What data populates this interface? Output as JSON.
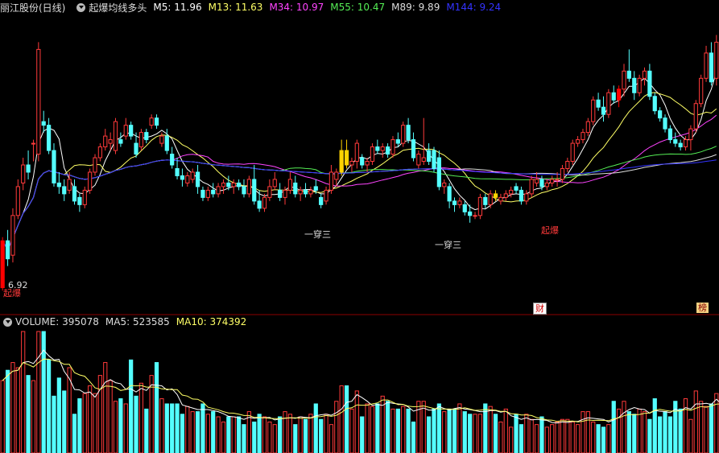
{
  "header": {
    "stock": "丽江股份(日线)",
    "indicator": "起爆均线多头",
    "ma": [
      {
        "label": "M5: 11.96",
        "color": "#ffffff"
      },
      {
        "label": "M13: 11.63",
        "color": "#ffff66"
      },
      {
        "label": "M34: 10.97",
        "color": "#ff44ff"
      },
      {
        "label": "M55: 10.47",
        "color": "#55ee55"
      },
      {
        "label": "M89: 9.89",
        "color": "#dddddd"
      },
      {
        "label": "M144: 9.24",
        "color": "#3333ff"
      }
    ]
  },
  "volume_header": {
    "volume": "VOLUME: 395078",
    "ma5": "MA5: 523585",
    "ma10": "MA10: 374392"
  },
  "annotations": {
    "low_price": "6.92",
    "qibao": "起爆",
    "yichuan_san": "一穿三",
    "cai": "财",
    "bang": "榜"
  },
  "colors": {
    "up": "#ff3a3a",
    "down": "#54ffff",
    "signal_yellow": "#ffd200",
    "signal_red": "#ff0000",
    "divider": "#8b0000",
    "vol_ma5": "#ffffff",
    "vol_ma10": "#ffff66"
  },
  "chart_data": {
    "type": "candlestick",
    "ylim_price": [
      6.5,
      14.3
    ],
    "candles": [
      [
        7.0,
        8.4,
        6.92,
        8.3
      ],
      [
        8.3,
        8.6,
        7.6,
        7.8
      ],
      [
        7.9,
        9.2,
        7.7,
        9.0
      ],
      [
        9.0,
        10.0,
        8.9,
        9.8
      ],
      [
        9.9,
        10.6,
        9.7,
        10.4
      ],
      [
        10.4,
        10.8,
        10.0,
        10.2
      ],
      [
        11.0,
        11.1,
        10.5,
        11.0
      ],
      [
        10.7,
        13.8,
        10.5,
        13.6
      ],
      [
        11.6,
        11.9,
        11.3,
        11.5
      ],
      [
        11.5,
        11.7,
        10.7,
        10.8
      ],
      [
        10.8,
        11.0,
        9.8,
        9.9
      ],
      [
        9.9,
        10.2,
        9.6,
        9.8
      ],
      [
        9.8,
        10.0,
        9.4,
        9.6
      ],
      [
        9.7,
        10.2,
        9.6,
        10.0
      ],
      [
        9.8,
        10.0,
        9.3,
        9.4
      ],
      [
        9.5,
        9.6,
        9.1,
        9.3
      ],
      [
        9.3,
        9.8,
        9.2,
        9.7
      ],
      [
        9.7,
        10.3,
        9.6,
        10.2
      ],
      [
        10.2,
        10.7,
        10.1,
        10.6
      ],
      [
        10.6,
        11.0,
        10.5,
        10.9
      ],
      [
        10.9,
        11.4,
        10.8,
        11.2
      ],
      [
        11.0,
        11.3,
        10.8,
        11.1
      ],
      [
        10.8,
        11.7,
        10.7,
        11.6
      ],
      [
        11.1,
        11.3,
        10.9,
        11.0
      ],
      [
        11.2,
        11.7,
        11.1,
        11.5
      ],
      [
        11.5,
        11.6,
        11.1,
        11.2
      ],
      [
        11.0,
        11.3,
        10.6,
        10.7
      ],
      [
        10.9,
        11.4,
        10.8,
        11.3
      ],
      [
        11.3,
        11.4,
        11.0,
        11.1
      ],
      [
        11.5,
        11.8,
        11.4,
        11.7
      ],
      [
        11.7,
        11.8,
        11.4,
        11.5
      ],
      [
        11.0,
        11.3,
        10.9,
        11.2
      ],
      [
        11.2,
        11.4,
        10.7,
        10.8
      ],
      [
        10.7,
        10.9,
        10.3,
        10.4
      ],
      [
        10.3,
        10.6,
        10.0,
        10.1
      ],
      [
        10.1,
        10.3,
        9.8,
        10.0
      ],
      [
        9.9,
        10.2,
        9.8,
        10.1
      ],
      [
        10.0,
        10.3,
        9.9,
        10.2
      ],
      [
        10.2,
        10.4,
        9.6,
        9.8
      ],
      [
        9.7,
        9.8,
        9.4,
        9.5
      ],
      [
        9.5,
        9.8,
        9.4,
        9.7
      ],
      [
        9.7,
        9.9,
        9.5,
        9.6
      ],
      [
        9.6,
        9.9,
        9.5,
        9.8
      ],
      [
        9.8,
        10.0,
        9.6,
        9.9
      ],
      [
        9.9,
        10.1,
        9.7,
        9.8
      ],
      [
        9.8,
        10.0,
        9.6,
        9.9
      ],
      [
        9.9,
        10.0,
        9.7,
        9.8
      ],
      [
        9.8,
        10.0,
        9.5,
        9.6
      ],
      [
        9.6,
        10.1,
        9.5,
        10.0
      ],
      [
        10.0,
        10.4,
        9.3,
        9.4
      ],
      [
        9.4,
        9.7,
        9.1,
        9.2
      ],
      [
        9.2,
        9.6,
        9.1,
        9.5
      ],
      [
        9.5,
        10.0,
        9.4,
        9.8
      ],
      [
        9.8,
        10.2,
        9.7,
        10.0
      ],
      [
        9.7,
        9.9,
        9.4,
        9.5
      ],
      [
        9.5,
        9.8,
        9.3,
        9.7
      ],
      [
        9.7,
        10.2,
        9.6,
        10.0
      ],
      [
        9.9,
        10.1,
        9.5,
        9.6
      ],
      [
        9.6,
        9.8,
        9.4,
        9.7
      ],
      [
        9.7,
        9.9,
        9.5,
        9.6
      ],
      [
        9.6,
        9.8,
        9.5,
        9.7
      ],
      [
        9.8,
        10.0,
        9.6,
        9.7
      ],
      [
        9.5,
        9.6,
        9.2,
        9.3
      ],
      [
        9.4,
        9.8,
        9.3,
        9.7
      ],
      [
        9.7,
        10.4,
        9.6,
        10.2
      ],
      [
        10.0,
        10.3,
        9.8,
        10.2
      ],
      [
        10.2,
        11.1,
        10.1,
        10.8
      ],
      [
        10.8,
        11.1,
        10.3,
        10.4
      ],
      [
        10.4,
        10.6,
        10.2,
        10.5
      ],
      [
        10.5,
        11.1,
        10.3,
        11.0
      ],
      [
        10.6,
        10.7,
        10.3,
        10.4
      ],
      [
        10.4,
        10.6,
        10.2,
        10.5
      ],
      [
        10.5,
        11.0,
        10.4,
        10.9
      ],
      [
        10.9,
        11.1,
        10.7,
        10.8
      ],
      [
        10.8,
        11.0,
        10.6,
        10.9
      ],
      [
        10.9,
        11.0,
        10.6,
        10.7
      ],
      [
        10.7,
        11.2,
        10.6,
        11.1
      ],
      [
        11.1,
        11.3,
        10.9,
        11.0
      ],
      [
        11.0,
        11.6,
        10.9,
        11.5
      ],
      [
        11.5,
        11.7,
        11.0,
        11.1
      ],
      [
        11.1,
        11.3,
        10.5,
        10.6
      ],
      [
        10.4,
        10.8,
        10.3,
        10.7
      ],
      [
        10.5,
        11.7,
        10.4,
        10.6
      ],
      [
        10.8,
        11.0,
        10.4,
        10.5
      ],
      [
        10.8,
        10.9,
        10.2,
        10.3
      ],
      [
        10.6,
        10.8,
        9.7,
        9.8
      ],
      [
        9.8,
        10.0,
        9.6,
        9.9
      ],
      [
        9.8,
        9.9,
        9.2,
        9.4
      ],
      [
        9.4,
        9.5,
        9.1,
        9.3
      ],
      [
        9.3,
        9.5,
        9.2,
        9.4
      ],
      [
        9.3,
        9.4,
        9.0,
        9.1
      ],
      [
        9.1,
        9.3,
        8.8,
        9.0
      ],
      [
        9.0,
        9.1,
        8.9,
        9.0
      ],
      [
        9.0,
        9.6,
        8.9,
        9.5
      ],
      [
        9.5,
        9.6,
        9.2,
        9.3
      ],
      [
        9.3,
        9.7,
        9.2,
        9.6
      ],
      [
        9.6,
        9.7,
        9.4,
        9.5
      ],
      [
        9.4,
        9.6,
        9.3,
        9.5
      ],
      [
        9.5,
        9.7,
        9.4,
        9.6
      ],
      [
        9.6,
        9.8,
        9.5,
        9.7
      ],
      [
        9.8,
        9.9,
        9.6,
        9.7
      ],
      [
        9.7,
        9.8,
        9.3,
        9.4
      ],
      [
        9.4,
        9.7,
        9.3,
        9.6
      ],
      [
        9.6,
        10.1,
        9.5,
        10.0
      ],
      [
        9.9,
        10.2,
        9.8,
        10.0
      ],
      [
        10.0,
        10.1,
        9.7,
        9.8
      ],
      [
        9.8,
        10.0,
        9.7,
        9.9
      ],
      [
        9.9,
        10.1,
        9.8,
        10.0
      ],
      [
        10.0,
        10.2,
        9.8,
        10.0
      ],
      [
        10.0,
        10.4,
        9.9,
        10.3
      ],
      [
        10.3,
        10.6,
        10.2,
        10.5
      ],
      [
        10.5,
        11.1,
        10.4,
        11.0
      ],
      [
        11.0,
        11.2,
        10.9,
        11.1
      ],
      [
        11.1,
        11.4,
        11.0,
        11.3
      ],
      [
        11.3,
        11.7,
        11.2,
        11.6
      ],
      [
        11.6,
        12.3,
        11.5,
        12.2
      ],
      [
        12.2,
        12.4,
        11.9,
        12.0
      ],
      [
        12.0,
        12.3,
        11.6,
        11.8
      ],
      [
        11.8,
        12.5,
        11.7,
        12.4
      ],
      [
        12.4,
        12.6,
        12.1,
        12.2
      ],
      [
        12.2,
        12.6,
        12.0,
        12.5
      ],
      [
        12.5,
        13.2,
        12.3,
        13.0
      ],
      [
        13.0,
        13.6,
        12.7,
        12.8
      ],
      [
        12.8,
        13.0,
        12.2,
        12.4
      ],
      [
        12.4,
        12.9,
        12.3,
        12.8
      ],
      [
        12.8,
        13.1,
        12.6,
        13.0
      ],
      [
        13.0,
        13.2,
        12.2,
        12.3
      ],
      [
        12.3,
        12.4,
        11.8,
        11.9
      ],
      [
        11.9,
        12.0,
        11.6,
        11.7
      ],
      [
        11.7,
        11.8,
        11.3,
        11.4
      ],
      [
        11.4,
        11.5,
        11.0,
        11.1
      ],
      [
        11.1,
        11.3,
        10.9,
        11.0
      ],
      [
        11.0,
        11.1,
        10.8,
        10.9
      ],
      [
        10.9,
        11.2,
        10.8,
        11.1
      ],
      [
        11.1,
        11.5,
        10.8,
        11.4
      ],
      [
        11.4,
        12.2,
        11.3,
        12.1
      ],
      [
        12.1,
        12.9,
        12.0,
        12.8
      ],
      [
        12.8,
        13.7,
        12.7,
        13.5
      ],
      [
        13.5,
        13.8,
        12.6,
        12.7
      ],
      [
        12.8,
        14.0,
        12.6,
        13.8
      ]
    ],
    "signals": [
      {
        "index": 0,
        "kind": "red"
      },
      {
        "index": 66,
        "kind": "yellow"
      },
      {
        "index": 67,
        "kind": "yellow"
      },
      {
        "index": 96,
        "kind": "yellow"
      },
      {
        "index": 120,
        "kind": "red"
      }
    ],
    "ma_periods": [
      5,
      13,
      34,
      55,
      89,
      144
    ],
    "volumes": [
      280,
      320,
      350,
      330,
      470,
      300,
      280,
      470,
      470,
      360,
      220,
      290,
      240,
      330,
      150,
      210,
      230,
      260,
      230,
      300,
      350,
      280,
      200,
      210,
      190,
      360,
      220,
      270,
      170,
      300,
      350,
      210,
      190,
      190,
      190,
      150,
      180,
      160,
      160,
      190,
      150,
      160,
      140,
      120,
      140,
      140,
      140,
      110,
      160,
      120,
      150,
      140,
      120,
      110,
      140,
      160,
      150,
      110,
      140,
      130,
      150,
      190,
      130,
      150,
      110,
      200,
      260,
      260,
      170,
      240,
      140,
      190,
      180,
      190,
      220,
      200,
      170,
      170,
      180,
      170,
      120,
      200,
      200,
      140,
      170,
      190,
      160,
      170,
      170,
      190,
      160,
      150,
      150,
      150,
      190,
      180,
      150,
      120,
      170,
      100,
      150,
      110,
      150,
      130,
      110,
      140,
      100,
      110,
      120,
      130,
      130,
      120,
      110,
      160,
      160,
      120,
      110,
      100,
      110,
      200,
      170,
      200,
      160,
      150,
      170,
      160,
      130,
      210,
      140,
      160,
      140,
      200,
      170,
      210,
      130,
      240,
      200,
      180,
      190,
      230,
      150,
      280,
      260,
      280
    ]
  }
}
